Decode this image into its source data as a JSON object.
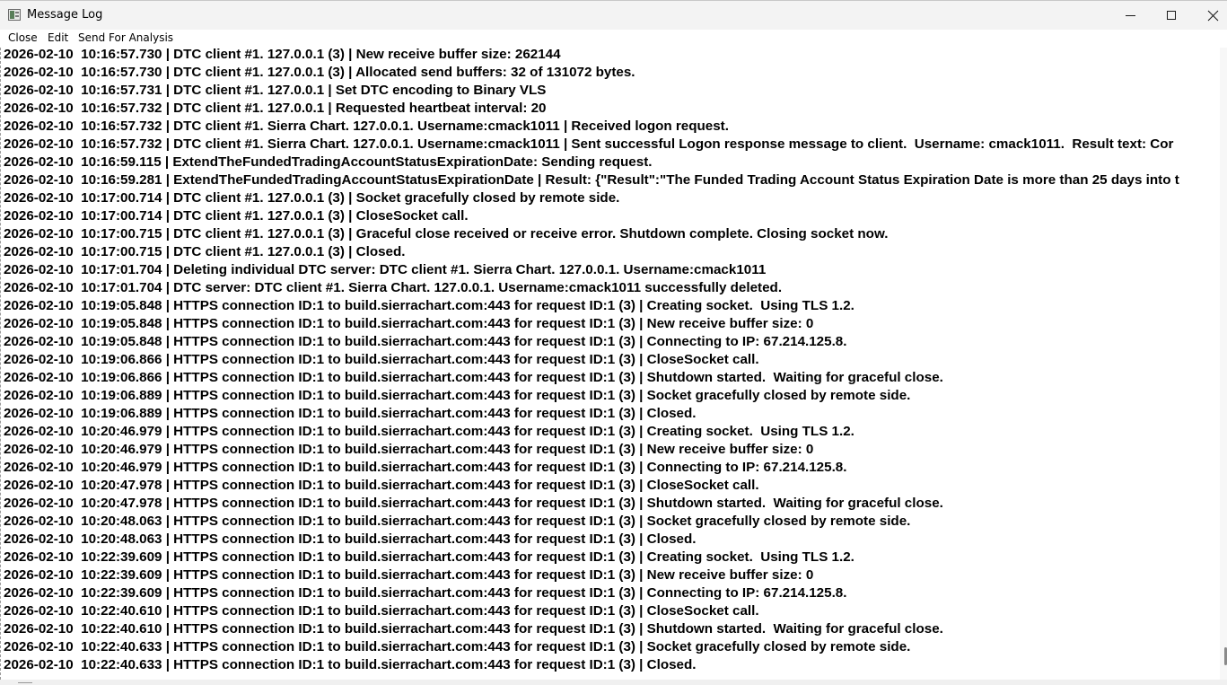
{
  "window": {
    "title": "Message Log",
    "app_icon": "message-log-app-icon",
    "controls": {
      "minimize_icon": "minimize-icon",
      "maximize_icon": "maximize-icon",
      "close_icon": "close-icon"
    }
  },
  "menu": {
    "items": [
      "Close",
      "Edit",
      "Send For Analysis"
    ]
  },
  "log": {
    "lines": [
      "2026-02-10  10:16:57.730 | DTC client #1. 127.0.0.1 (3) | New receive buffer size: 262144",
      "2026-02-10  10:16:57.730 | DTC client #1. 127.0.0.1 (3) | Allocated send buffers: 32 of 131072 bytes.",
      "2026-02-10  10:16:57.731 | DTC client #1. 127.0.0.1 | Set DTC encoding to Binary VLS",
      "2026-02-10  10:16:57.732 | DTC client #1. 127.0.0.1 | Requested heartbeat interval: 20",
      "2026-02-10  10:16:57.732 | DTC client #1. Sierra Chart. 127.0.0.1. Username:cmack1011 | Received logon request.",
      "2026-02-10  10:16:57.732 | DTC client #1. Sierra Chart. 127.0.0.1. Username:cmack1011 | Sent successful Logon response message to client.  Username: cmack1011.  Result text: Cor",
      "2026-02-10  10:16:59.115 | ExtendTheFundedTradingAccountStatusExpirationDate: Sending request.",
      "2026-02-10  10:16:59.281 | ExtendTheFundedTradingAccountStatusExpirationDate | Result: {\"Result\":\"The Funded Trading Account Status Expiration Date is more than 25 days into t",
      "2026-02-10  10:17:00.714 | DTC client #1. 127.0.0.1 (3) | Socket gracefully closed by remote side.",
      "2026-02-10  10:17:00.714 | DTC client #1. 127.0.0.1 (3) | CloseSocket call.",
      "2026-02-10  10:17:00.715 | DTC client #1. 127.0.0.1 (3) | Graceful close received or receive error. Shutdown complete. Closing socket now.",
      "2026-02-10  10:17:00.715 | DTC client #1. 127.0.0.1 (3) | Closed.",
      "2026-02-10  10:17:01.704 | Deleting individual DTC server: DTC client #1. Sierra Chart. 127.0.0.1. Username:cmack1011",
      "2026-02-10  10:17:01.704 | DTC server: DTC client #1. Sierra Chart. 127.0.0.1. Username:cmack1011 successfully deleted.",
      "2026-02-10  10:19:05.848 | HTTPS connection ID:1 to build.sierrachart.com:443 for request ID:1 (3) | Creating socket.  Using TLS 1.2.",
      "2026-02-10  10:19:05.848 | HTTPS connection ID:1 to build.sierrachart.com:443 for request ID:1 (3) | New receive buffer size: 0",
      "2026-02-10  10:19:05.848 | HTTPS connection ID:1 to build.sierrachart.com:443 for request ID:1 (3) | Connecting to IP: 67.214.125.8.",
      "2026-02-10  10:19:06.866 | HTTPS connection ID:1 to build.sierrachart.com:443 for request ID:1 (3) | CloseSocket call.",
      "2026-02-10  10:19:06.866 | HTTPS connection ID:1 to build.sierrachart.com:443 for request ID:1 (3) | Shutdown started.  Waiting for graceful close.",
      "2026-02-10  10:19:06.889 | HTTPS connection ID:1 to build.sierrachart.com:443 for request ID:1 (3) | Socket gracefully closed by remote side.",
      "2026-02-10  10:19:06.889 | HTTPS connection ID:1 to build.sierrachart.com:443 for request ID:1 (3) | Closed.",
      "2026-02-10  10:20:46.979 | HTTPS connection ID:1 to build.sierrachart.com:443 for request ID:1 (3) | Creating socket.  Using TLS 1.2.",
      "2026-02-10  10:20:46.979 | HTTPS connection ID:1 to build.sierrachart.com:443 for request ID:1 (3) | New receive buffer size: 0",
      "2026-02-10  10:20:46.979 | HTTPS connection ID:1 to build.sierrachart.com:443 for request ID:1 (3) | Connecting to IP: 67.214.125.8.",
      "2026-02-10  10:20:47.978 | HTTPS connection ID:1 to build.sierrachart.com:443 for request ID:1 (3) | CloseSocket call.",
      "2026-02-10  10:20:47.978 | HTTPS connection ID:1 to build.sierrachart.com:443 for request ID:1 (3) | Shutdown started.  Waiting for graceful close.",
      "2026-02-10  10:20:48.063 | HTTPS connection ID:1 to build.sierrachart.com:443 for request ID:1 (3) | Socket gracefully closed by remote side.",
      "2026-02-10  10:20:48.063 | HTTPS connection ID:1 to build.sierrachart.com:443 for request ID:1 (3) | Closed.",
      "2026-02-10  10:22:39.609 | HTTPS connection ID:1 to build.sierrachart.com:443 for request ID:1 (3) | Creating socket.  Using TLS 1.2.",
      "2026-02-10  10:22:39.609 | HTTPS connection ID:1 to build.sierrachart.com:443 for request ID:1 (3) | New receive buffer size: 0",
      "2026-02-10  10:22:39.609 | HTTPS connection ID:1 to build.sierrachart.com:443 for request ID:1 (3) | Connecting to IP: 67.214.125.8.",
      "2026-02-10  10:22:40.610 | HTTPS connection ID:1 to build.sierrachart.com:443 for request ID:1 (3) | CloseSocket call.",
      "2026-02-10  10:22:40.610 | HTTPS connection ID:1 to build.sierrachart.com:443 for request ID:1 (3) | Shutdown started.  Waiting for graceful close.",
      "2026-02-10  10:22:40.633 | HTTPS connection ID:1 to build.sierrachart.com:443 for request ID:1 (3) | Socket gracefully closed by remote side.",
      "2026-02-10  10:22:40.633 | HTTPS connection ID:1 to build.sierrachart.com:443 for request ID:1 (3) | Closed."
    ]
  },
  "colors": {
    "text": "#000000",
    "titlebar": "#f3f3f3",
    "background": "#ffffff"
  }
}
